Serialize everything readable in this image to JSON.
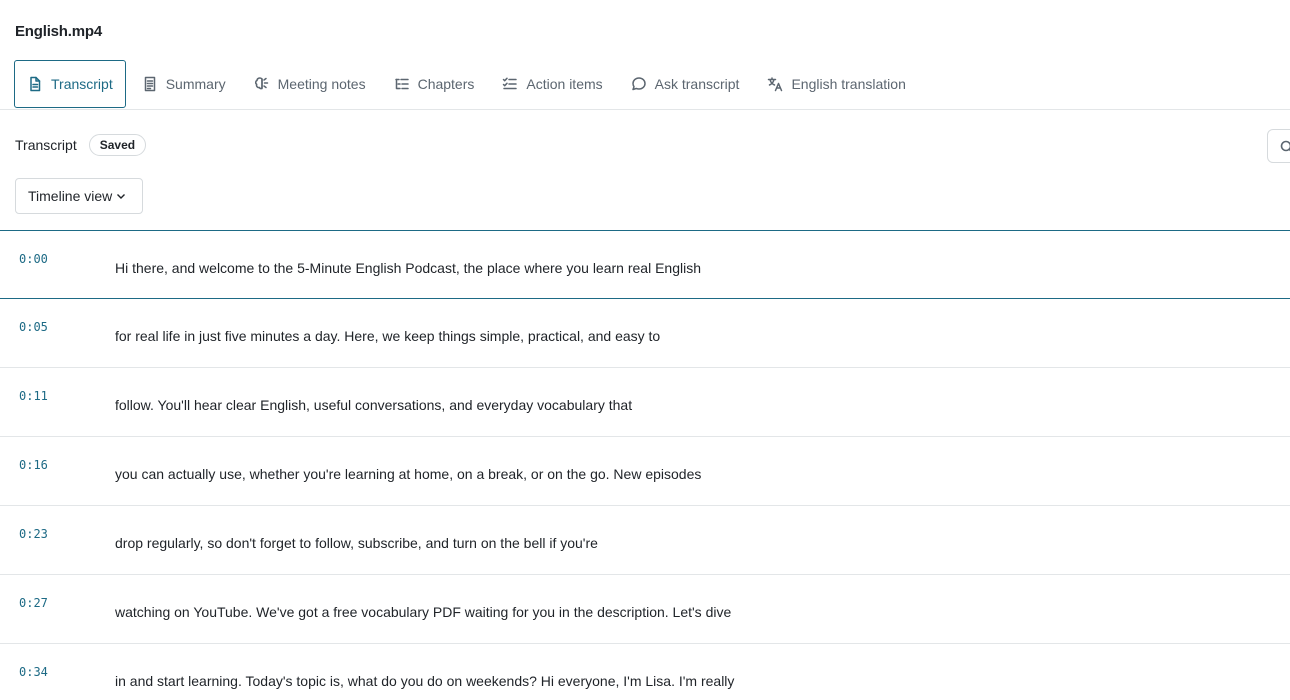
{
  "file": {
    "title": "English.mp4"
  },
  "tabs": [
    {
      "label": "Transcript",
      "icon": "document-icon",
      "active": true
    },
    {
      "label": "Summary",
      "icon": "summary-icon",
      "active": false
    },
    {
      "label": "Meeting notes",
      "icon": "brain-icon",
      "active": false
    },
    {
      "label": "Chapters",
      "icon": "chapters-icon",
      "active": false
    },
    {
      "label": "Action items",
      "icon": "checklist-icon",
      "active": false
    },
    {
      "label": "Ask transcript",
      "icon": "chat-bubble-icon",
      "active": false
    },
    {
      "label": "English translation",
      "icon": "translate-icon",
      "active": false
    }
  ],
  "transcript": {
    "title": "Transcript",
    "status": "Saved",
    "view": "Timeline view",
    "segments": [
      {
        "time": "0:00",
        "text": "Hi there, and welcome to the 5-Minute English Podcast, the place where you learn real English"
      },
      {
        "time": "0:05",
        "text": "for real life in just five minutes a day. Here, we keep things simple, practical, and easy to"
      },
      {
        "time": "0:11",
        "text": "follow. You'll hear clear English, useful conversations, and everyday vocabulary that"
      },
      {
        "time": "0:16",
        "text": "you can actually use, whether you're learning at home, on a break, or on the go. New episodes"
      },
      {
        "time": "0:23",
        "text": "drop regularly, so don't forget to follow, subscribe, and turn on the bell if you're"
      },
      {
        "time": "0:27",
        "text": "watching on YouTube. We've got a free vocabulary PDF waiting for you in the description. Let's dive"
      },
      {
        "time": "0:34",
        "text": "in and start learning. Today's topic is, what do you do on weekends? Hi everyone, I'm Lisa. I'm really"
      }
    ]
  },
  "colors": {
    "accent": "#1d6a85",
    "divider": "#e3e6e8",
    "text": "#1f2328",
    "muted": "#5c6670"
  }
}
